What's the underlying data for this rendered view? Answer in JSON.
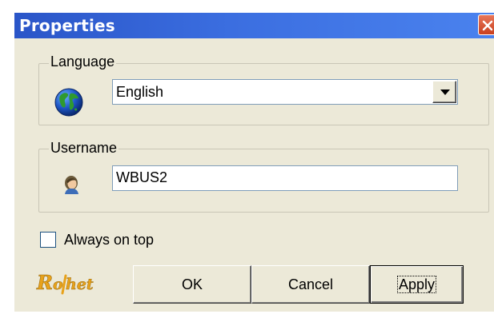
{
  "window": {
    "title": "Properties",
    "close_icon": "close-icon"
  },
  "language_group": {
    "label": "Language",
    "icon": "globe-icon",
    "selected": "English",
    "dropdown_icon": "dropdown-arrow-icon"
  },
  "username_group": {
    "label": "Username",
    "icon": "user-icon",
    "value": "WBUS2"
  },
  "always_on_top": {
    "label": "Always on top",
    "checked": false
  },
  "logo": {
    "text": "Rohet",
    "color": "#e8a21b"
  },
  "buttons": {
    "ok": "OK",
    "cancel": "Cancel",
    "apply": "Apply"
  },
  "colors": {
    "titlebar": "#3b6ee0",
    "dialog_face": "#ece9d8",
    "close_button": "#d9572f",
    "field_border": "#7f9db9"
  }
}
